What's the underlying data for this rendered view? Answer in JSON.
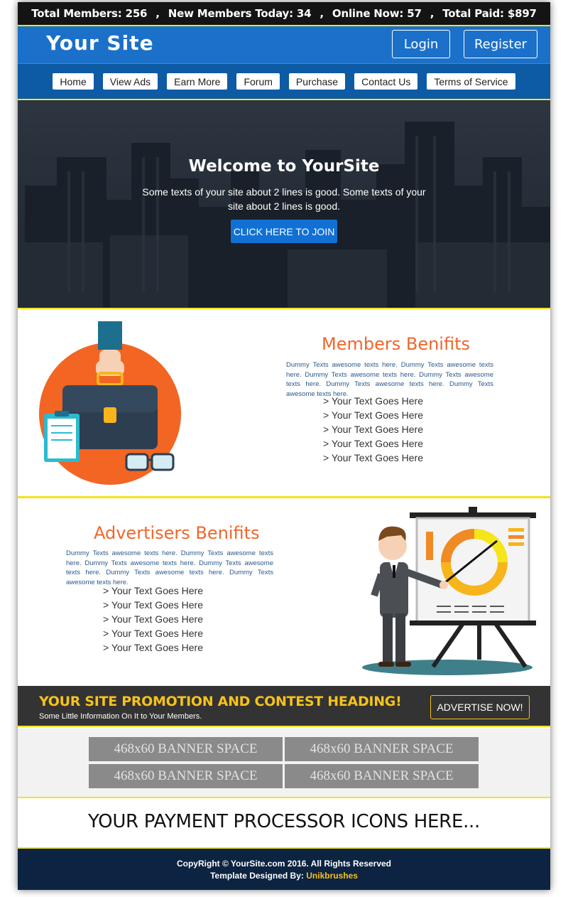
{
  "stats": {
    "total_members": "Total Members: 256",
    "new_members": "New Members Today: 34",
    "online": "Online Now: 57",
    "total_paid": "Total Paid: $897",
    "separator": ","
  },
  "header": {
    "logo": "Your Site",
    "login_label": "Login",
    "register_label": "Register"
  },
  "nav": {
    "items": [
      "Home",
      "View Ads",
      "Earn More",
      "Forum",
      "Purchase",
      "Contact Us",
      "Terms of Service"
    ]
  },
  "hero": {
    "title": "Welcome to YourSite",
    "text": "Some texts of your site about 2 lines is good. Some texts of your site about 2 lines is good.",
    "cta_label": "CLICK HERE TO JOIN"
  },
  "members": {
    "title": "Members Benifits",
    "dummy": "Dummy Texts awesome texts here. Dummy Texts awesome texts here. Dummy Texts awesome texts here. Dummy Texts awesome texts here. Dummy Texts awesome texts here. Dummy Texts awesome texts here.",
    "bullets": [
      "> Your Text Goes Here",
      "> Your Text Goes Here",
      "> Your Text Goes Here",
      "> Your Text Goes Here",
      "> Your Text Goes Here"
    ]
  },
  "advertisers": {
    "title": "Advertisers Benifits",
    "dummy": "Dummy Texts awesome texts here. Dummy Texts awesome texts here. Dummy Texts awesome texts here. Dummy Texts awesome texts here. Dummy Texts awesome texts here. Dummy Texts awesome texts here.",
    "bullets": [
      "> Your Text Goes Here",
      "> Your Text Goes Here",
      "> Your Text Goes Here",
      "> Your Text Goes Here",
      "> Your Text Goes Here"
    ]
  },
  "promo": {
    "title": "YOUR SITE PROMOTION AND CONTEST HEADING!",
    "subtitle": "Some Little Information On It to Your Members.",
    "button_label": "ADVERTISE NOW!"
  },
  "banners": [
    "468x60 BANNER SPACE",
    "468x60 BANNER SPACE",
    "468x60 BANNER SPACE",
    "468x60 BANNER SPACE"
  ],
  "payments": {
    "text": "YOUR PAYMENT PROCESSOR ICONS HERE..."
  },
  "footer": {
    "copyright": "CopyRight © YourSite.com 2016. All Rights Reserved",
    "designed_by_label": "Template Designed By:",
    "designer": "Unikbrushes"
  },
  "colors": {
    "header_blue": "#1b70c9",
    "nav_blue": "#0d5aa5",
    "accent_yellow": "#f2e41e",
    "section_orange": "#f0662a",
    "promo_yellow": "#f7c21b",
    "footer_navy": "#0c2341"
  },
  "icons": {
    "members_illustration": "briefcase-hand-icon",
    "advertisers_illustration": "presenter-chart-icon"
  }
}
